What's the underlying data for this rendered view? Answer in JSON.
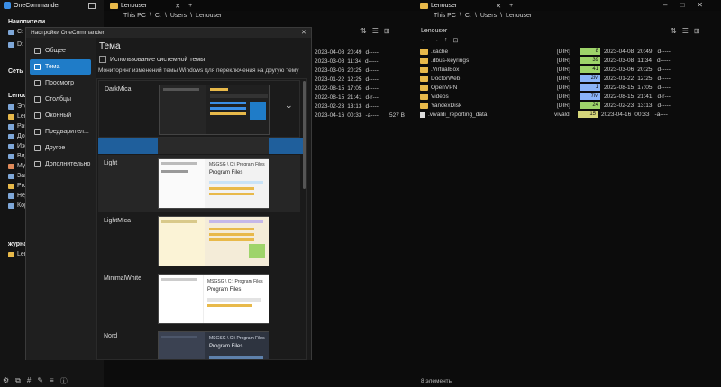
{
  "app": {
    "title": "OneCommander"
  },
  "tabs": {
    "left": "Lenouser",
    "right": "Lenouser"
  },
  "breadcrumbs": {
    "left": [
      "This PC",
      "C:",
      "Users",
      "Lenouser"
    ],
    "right": [
      "This PC",
      "C:",
      "Users",
      "Lenouser"
    ]
  },
  "sidebar": {
    "drives_heading": "Накопители",
    "drives": [
      "C:",
      "D:"
    ],
    "network_heading": "Сеть",
    "user_heading": "Lenouser",
    "items": [
      "Этот",
      "Lenouser",
      "Раб",
      "Док",
      "Изо",
      "Вид",
      "Муз",
      "Загр",
      "Prog",
      "Нед",
      "Кор"
    ],
    "journal_heading": "журнал",
    "journal_items": [
      "Lenouser"
    ]
  },
  "right_pane": {
    "folder_title": "Lenouser",
    "rows": [
      {
        "name": ".cache",
        "type": "[DIR]",
        "size": "8",
        "size_color": "#9ed46a",
        "date": "2023-04-08",
        "time": "20:49",
        "attr": "d-----"
      },
      {
        "name": ".dbus-keyrings",
        "type": "[DIR]",
        "size": "39",
        "size_color": "#9ed46a",
        "date": "2023-03-08",
        "time": "11:34",
        "attr": "d-----"
      },
      {
        "name": ".VirtualBox",
        "type": "[DIR]",
        "size": "41",
        "size_color": "#9ed46a",
        "date": "2023-03-06",
        "time": "20:25",
        "attr": "d-----"
      },
      {
        "name": "DoctorWeb",
        "type": "[DIR]",
        "size": "2M",
        "size_color": "#8ab4f8",
        "date": "2023-01-22",
        "time": "12:25",
        "attr": "d-----"
      },
      {
        "name": "OpenVPN",
        "type": "[DIR]",
        "size": "1",
        "size_color": "#8ab4f8",
        "date": "2022-08-15",
        "time": "17:05",
        "attr": "d-----"
      },
      {
        "name": "Videos",
        "type": "[DIR]",
        "size": "7M",
        "size_color": "#8ab4f8",
        "date": "2022-08-15",
        "time": "21:41",
        "attr": "d-r---"
      },
      {
        "name": "YandexDisk",
        "type": "[DIR]",
        "size": "24",
        "size_color": "#9ed46a",
        "date": "2023-02-23",
        "time": "13:13",
        "attr": "d-----"
      },
      {
        "name": ".vivaldi_reporting_data",
        "type": "vivaldi",
        "size": "15",
        "size_color": "#d6d67a",
        "date": "2023-04-16",
        "time": "00:33",
        "attr": "-a----"
      }
    ],
    "status": "8 элементы"
  },
  "left_pane": {
    "rows": [
      {
        "date": "2023-04-08",
        "time": "20:49",
        "attr": "d-----"
      },
      {
        "date": "2023-03-08",
        "time": "11:34",
        "attr": "d-----"
      },
      {
        "date": "2023-03-06",
        "time": "20:25",
        "attr": "d-----"
      },
      {
        "date": "2023-01-22",
        "time": "12:25",
        "attr": "d-----"
      },
      {
        "date": "2022-08-15",
        "time": "17:05",
        "attr": "d-----"
      },
      {
        "date": "2022-08-15",
        "time": "21:41",
        "attr": "d-r---"
      },
      {
        "date": "2023-02-23",
        "time": "13:13",
        "attr": "d-----"
      },
      {
        "date": "2023-04-16",
        "time": "00:33",
        "attr": "-a----",
        "size": "527 B"
      }
    ]
  },
  "dialog": {
    "title": "Настройки OneCommander",
    "nav": [
      "Общее",
      "Тема",
      "Просмотр",
      "Столбцы",
      "Оконный",
      "Предварител...",
      "Другое",
      "Дополнительно"
    ],
    "active_nav": "Тема",
    "heading": "Тема",
    "checkbox_label": "Использование системной темы",
    "description": "Мониторинг изменений темы Windows для переключения на другую тему",
    "themes": [
      "DarkMica",
      "Light",
      "LightMica",
      "MinimalWhite",
      "Nord"
    ],
    "selected_theme": "DarkMica",
    "thumb_path": "MSGSG \\ C:\\ Program Files",
    "thumb_folder": "Program Files"
  }
}
